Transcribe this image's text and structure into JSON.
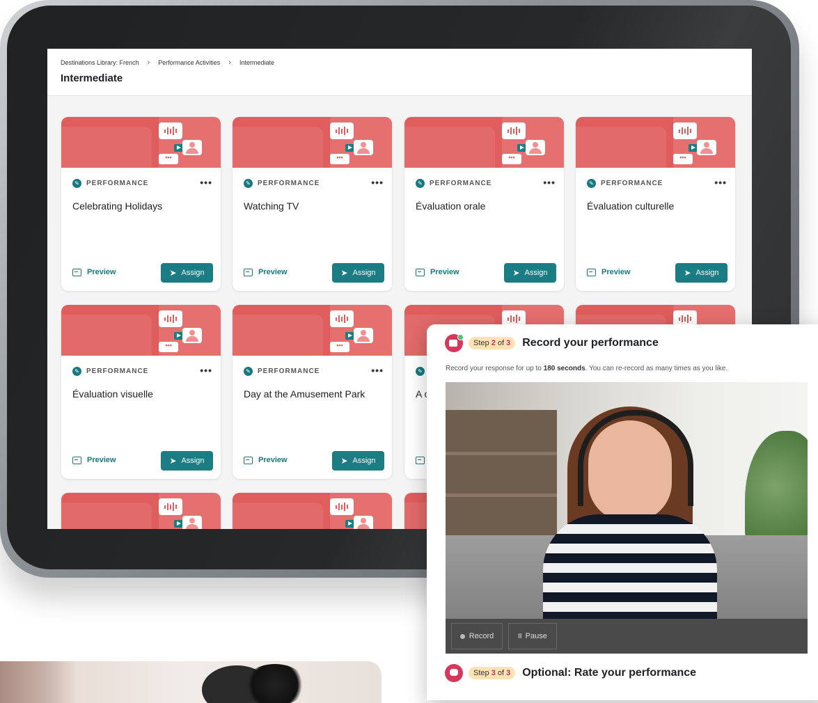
{
  "breadcrumb": [
    "Destinations Library: French",
    "Performance Activities",
    "Intermediate"
  ],
  "page_title": "Intermediate",
  "card_tag": "PERFORMANCE",
  "more_label": "•••",
  "preview_label": "Preview",
  "assign_label": "Assign",
  "cards": [
    {
      "title": "Celebrating Holidays"
    },
    {
      "title": "Watching TV"
    },
    {
      "title": "Évaluation orale"
    },
    {
      "title": "Évaluation culturelle"
    },
    {
      "title": "Évaluation visuelle"
    },
    {
      "title": "Day at the Amusement Park"
    },
    {
      "title": "A c"
    },
    {
      "title": ""
    }
  ],
  "overlay": {
    "step2": {
      "prefix": "Step ",
      "num": "2",
      "of": " of ",
      "total": "3",
      "title": "Record your performance"
    },
    "description_pre": "Record your response for up to ",
    "description_bold": "180 seconds",
    "description_post": ". You can re-record as many times as you like.",
    "record_label": "Record",
    "pause_label": "Pause",
    "step3": {
      "prefix": "Step ",
      "num": "3",
      "of": " of ",
      "total": "3",
      "title": "Optional: Rate your performance"
    }
  },
  "colors": {
    "banner": "#e05d5d",
    "accent_teal": "#1a7d84",
    "step_pill": "#fde3b4",
    "step_icon": "#d6375a"
  }
}
